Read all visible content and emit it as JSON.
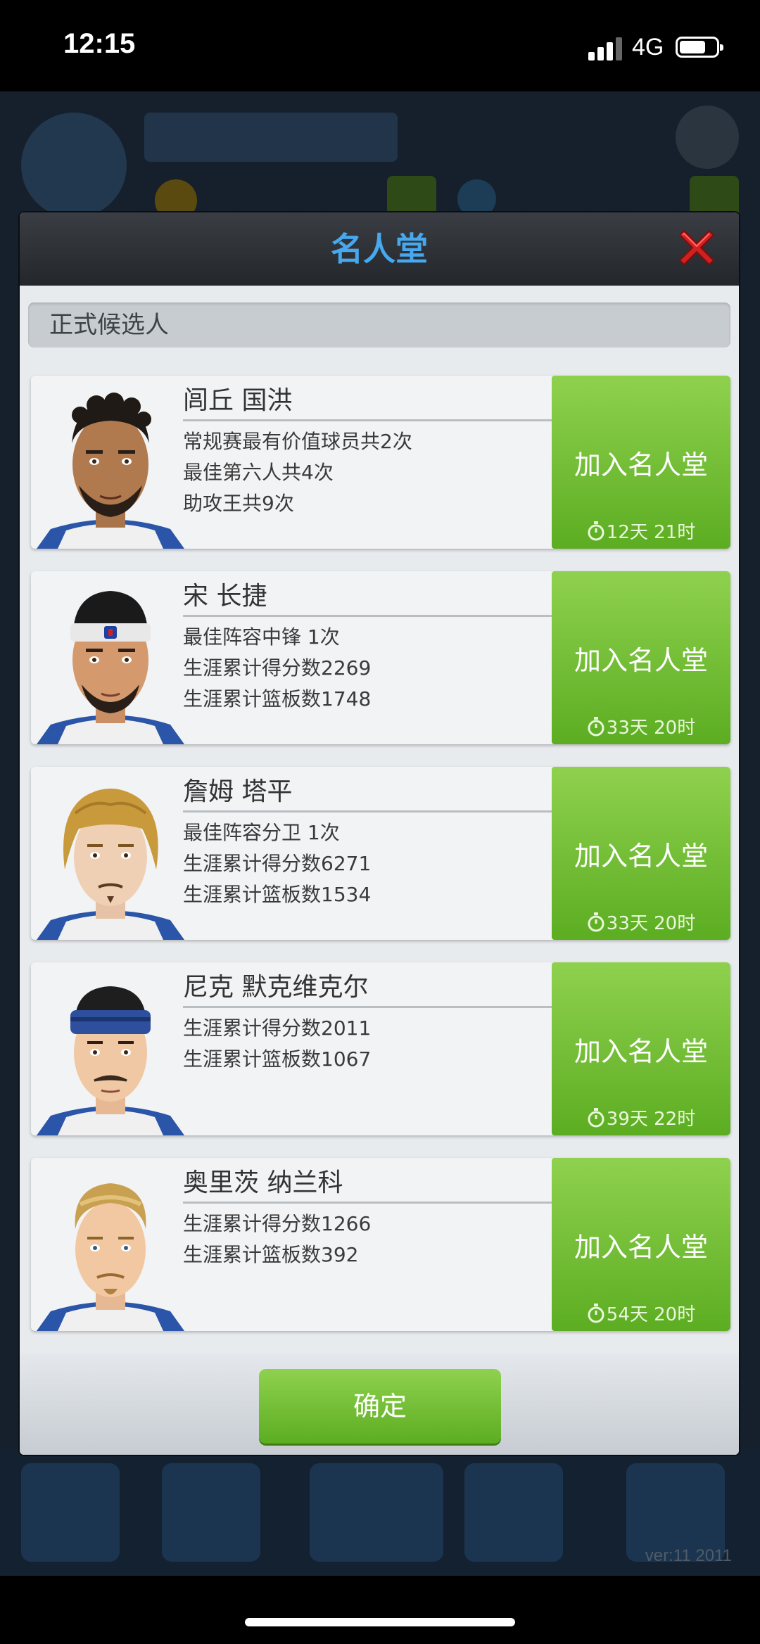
{
  "status_bar": {
    "time": "12:15",
    "network": "4G"
  },
  "background": {
    "version": "ver:11  2011"
  },
  "dialog": {
    "title": "名人堂",
    "section_label": "正式候选人",
    "join_label": "加入名人堂",
    "candidates": [
      {
        "name": "闾丘 国洪",
        "stats": [
          "常规赛最有价值球员共2次",
          "最佳第六人共4次",
          "助攻王共9次"
        ],
        "timer": "12天 21时"
      },
      {
        "name": "宋 长捷",
        "stats": [
          "最佳阵容中锋  1次",
          "生涯累计得分数2269",
          "生涯累计篮板数1748"
        ],
        "timer": "33天 20时"
      },
      {
        "name": "詹姆 塔平",
        "stats": [
          "最佳阵容分卫  1次",
          "生涯累计得分数6271",
          "生涯累计篮板数1534"
        ],
        "timer": "33天 20时"
      },
      {
        "name": "尼克 默克维克尔",
        "stats": [
          "生涯累计得分数2011",
          "生涯累计篮板数1067"
        ],
        "timer": "39天 22时"
      },
      {
        "name": "奥里茨 纳兰科",
        "stats": [
          "生涯累计得分数1266",
          "生涯累计篮板数392"
        ],
        "timer": "54天 20时"
      }
    ],
    "confirm_label": "确定"
  },
  "colors": {
    "title": "#47a8ee",
    "button_green": "#6fbe2f",
    "close_red": "#d22020"
  },
  "icons": {
    "close": "close-x-icon",
    "timer": "stopwatch-icon"
  }
}
